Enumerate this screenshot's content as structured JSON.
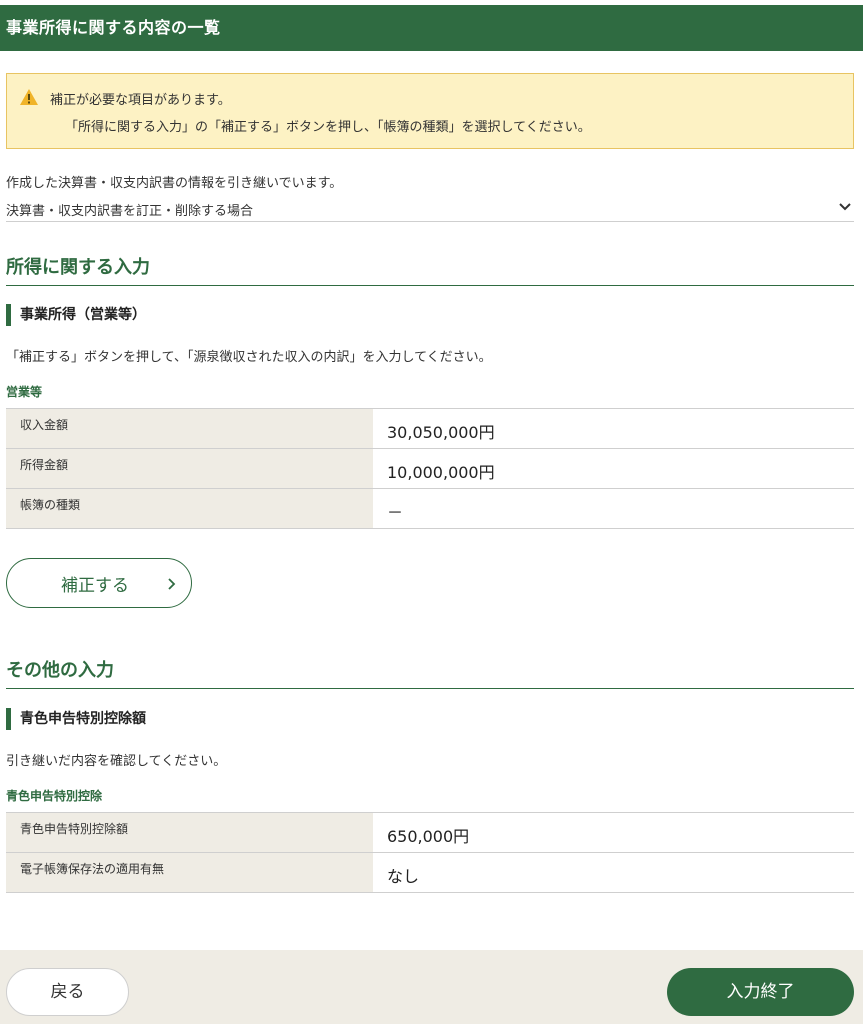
{
  "header": {
    "title": "事業所得に関する内容の一覧"
  },
  "alert": {
    "line1": "補正が必要な項目があります。",
    "line2": "「所得に関する入力」の「補正する」ボタンを押し、「帳簿の種類」を選択してください。"
  },
  "intro": "作成した決算書・収支内訳書の情報を引き継いでいます。",
  "collapse": {
    "label": "決算書・収支内訳書を訂正・削除する場合"
  },
  "income_section": {
    "title": "所得に関する入力",
    "subsection": "事業所得（営業等）",
    "note": "「補正する」ボタンを押して、「源泉徴収された収入の内訳」を入力してください。",
    "group": "営業等",
    "rows": [
      {
        "label": "収入金額",
        "value": "30,050,000円"
      },
      {
        "label": "所得金額",
        "value": "10,000,000円"
      },
      {
        "label": "帳簿の種類",
        "value": "－"
      }
    ],
    "fix_button": "補正する"
  },
  "other_section": {
    "title": "その他の入力",
    "subsection": "青色申告特別控除額",
    "note": "引き継いだ内容を確認してください。",
    "group": "青色申告特別控除",
    "rows": [
      {
        "label": "青色申告特別控除額",
        "value": "650,000円"
      },
      {
        "label": "電子帳簿保存法の適用有無",
        "value": "なし"
      }
    ]
  },
  "footer": {
    "back_label": "戻る",
    "done_label": "入力終了"
  },
  "colors": {
    "brand_green": "#2f6b41",
    "alert_bg": "#fdf2c4",
    "alert_icon": "#f0b429"
  }
}
